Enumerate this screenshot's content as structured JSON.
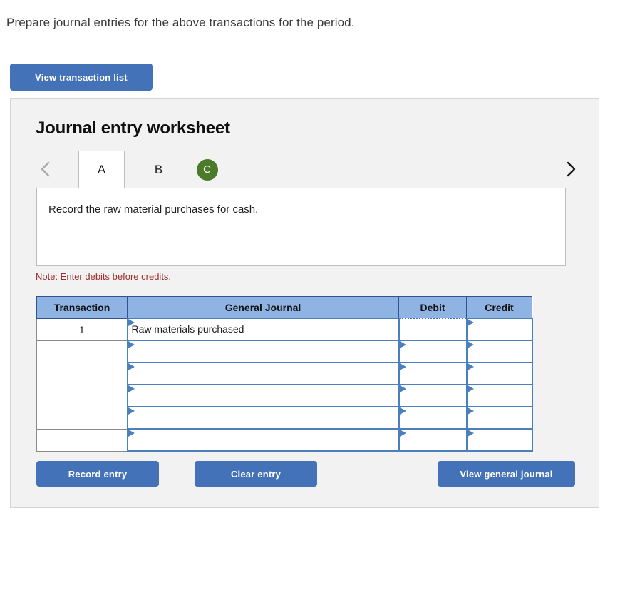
{
  "prompt": "Prepare journal entries for the above transactions for the period.",
  "toolbar": {
    "view_transaction_list_label": "View transaction list"
  },
  "panel": {
    "title": "Journal entry worksheet",
    "nav": {
      "prev_icon": "chevron-left-icon",
      "next_icon": "chevron-right-icon"
    },
    "tabs": [
      {
        "label": "A",
        "active": true,
        "badge": false
      },
      {
        "label": "B",
        "active": false,
        "badge": false
      },
      {
        "label": "C",
        "active": false,
        "badge": true,
        "badge_color": "#4B7A2B"
      }
    ],
    "description": "Record the raw material purchases for cash.",
    "note": "Note: Enter debits before credits.",
    "note_color": "#9B2C2C",
    "accent_button_color": "#4472B8",
    "table_header_color": "#8FB4E3",
    "cell_border_color": "#4B7FBE"
  },
  "table": {
    "columns": [
      "Transaction",
      "General Journal",
      "Debit",
      "Credit"
    ],
    "rows": [
      {
        "transaction": "1",
        "general_journal": "Raw materials purchased",
        "debit": "",
        "credit": "",
        "debit_focused": true
      },
      {
        "transaction": "",
        "general_journal": "",
        "debit": "",
        "credit": "",
        "debit_focused": false
      },
      {
        "transaction": "",
        "general_journal": "",
        "debit": "",
        "credit": "",
        "debit_focused": false
      },
      {
        "transaction": "",
        "general_journal": "",
        "debit": "",
        "credit": "",
        "debit_focused": false
      },
      {
        "transaction": "",
        "general_journal": "",
        "debit": "",
        "credit": "",
        "debit_focused": false
      },
      {
        "transaction": "",
        "general_journal": "",
        "debit": "",
        "credit": "",
        "debit_focused": false
      }
    ]
  },
  "actions": {
    "record_entry_label": "Record entry",
    "clear_entry_label": "Clear entry",
    "view_general_journal_label": "View general journal"
  }
}
